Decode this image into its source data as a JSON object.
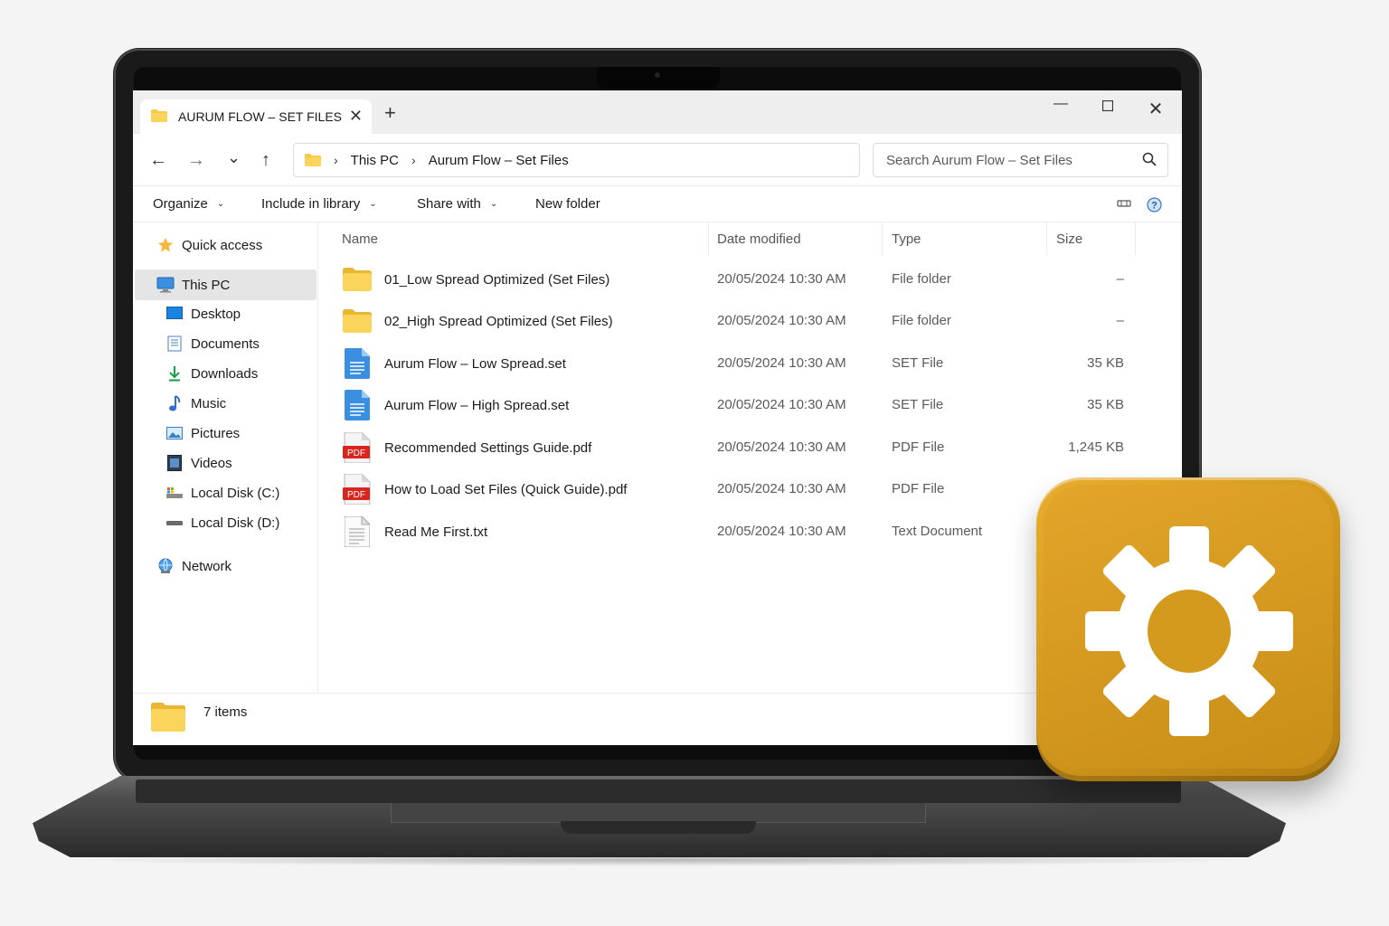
{
  "window": {
    "tab_title": "AURUM FLOW – SET FILES",
    "tab_close": "✕",
    "new_tab": "+",
    "minimize": "—",
    "maximize": "☐",
    "close": "✕"
  },
  "nav": {
    "back": "←",
    "forward": "→",
    "recent": "⌄",
    "up": "↑",
    "breadcrumb": [
      "This PC",
      "Aurum Flow – Set Files"
    ],
    "breadcrumb_sep": "›",
    "search_placeholder": "Search Aurum Flow – Set Files"
  },
  "toolbar": {
    "organize": "Organize",
    "include_in_library": "Include in library",
    "share_with": "Share with",
    "new_folder": "New folder"
  },
  "sidebar": {
    "items": [
      {
        "label": "Quick access",
        "icon": "star-icon"
      },
      {
        "label": "This PC",
        "icon": "computer-icon",
        "selected": true
      },
      {
        "label": "Desktop",
        "icon": "desktop-icon"
      },
      {
        "label": "Documents",
        "icon": "documents-icon"
      },
      {
        "label": "Downloads",
        "icon": "download-icon"
      },
      {
        "label": "Music",
        "icon": "music-icon"
      },
      {
        "label": "Pictures",
        "icon": "pictures-icon"
      },
      {
        "label": "Videos",
        "icon": "videos-icon"
      },
      {
        "label": "Local Disk (C:)",
        "icon": "disk-icon"
      },
      {
        "label": "Local Disk (D:)",
        "icon": "disk-icon"
      },
      {
        "label": "Network",
        "icon": "network-icon"
      }
    ]
  },
  "columns": {
    "name": "Name",
    "date": "Date modified",
    "type": "Type",
    "size": "Size"
  },
  "files": [
    {
      "name": "01_Low Spread Optimized (Set Files)",
      "date": "20/05/2024 10:30 AM",
      "type": "File folder",
      "size": "–",
      "icon": "folder-icon"
    },
    {
      "name": "02_High Spread Optimized (Set Files)",
      "date": "20/05/2024 10:30 AM",
      "type": "File folder",
      "size": "–",
      "icon": "folder-icon"
    },
    {
      "name": "Aurum Flow – Low Spread.set",
      "date": "20/05/2024 10:30 AM",
      "type": "SET File",
      "size": "35 KB",
      "icon": "set-file-icon"
    },
    {
      "name": "Aurum Flow – High Spread.set",
      "date": "20/05/2024 10:30 AM",
      "type": "SET File",
      "size": "35 KB",
      "icon": "set-file-icon"
    },
    {
      "name": "Recommended Settings Guide.pdf",
      "date": "20/05/2024 10:30 AM",
      "type": "PDF File",
      "size": "1,245 KB",
      "icon": "pdf-icon"
    },
    {
      "name": "How to Load Set Files (Quick Guide).pdf",
      "date": "20/05/2024 10:30 AM",
      "type": "PDF File",
      "size": "",
      "icon": "pdf-icon"
    },
    {
      "name": "Read Me First.txt",
      "date": "20/05/2024 10:30 AM",
      "type": "Text Document",
      "size": "",
      "icon": "text-file-icon"
    }
  ],
  "pdf_badge": "PDF",
  "status": {
    "items_count": "7 items"
  },
  "colors": {
    "folder": "#f7c948",
    "gear_tile": "#d49a1d",
    "selection": "#e5e5e5"
  }
}
